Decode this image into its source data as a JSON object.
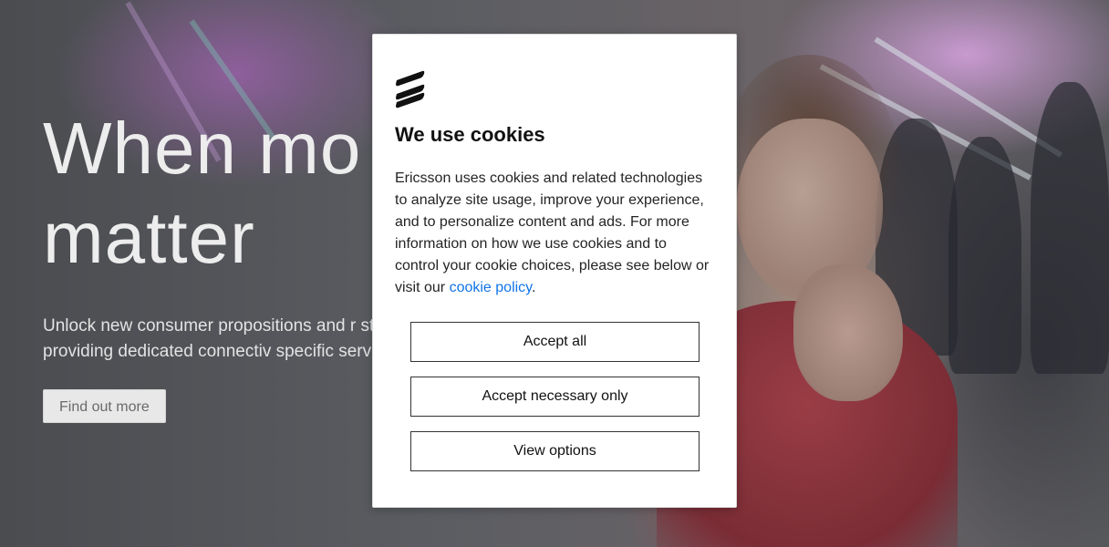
{
  "hero": {
    "title_line1": "When mo",
    "title_line2": "matter",
    "description": "Unlock new consumer propositions and r streams by providing dedicated connectiv specific services",
    "cta_label": "Find out more"
  },
  "cookie_dialog": {
    "logo_icon": "ericsson-logo-icon",
    "title": "We use cookies",
    "body_text": "Ericsson uses cookies and related technologies to analyze site usage, improve your experience, and to personalize content and ads. For more information on how we use cookies and to control your cookie choices, please see below or visit our ",
    "policy_link": "cookie policy",
    "body_end": ".",
    "accept_all_label": "Accept all",
    "accept_necessary_label": "Accept necessary only",
    "view_options_label": "View options",
    "link_color": "#1174e6"
  }
}
